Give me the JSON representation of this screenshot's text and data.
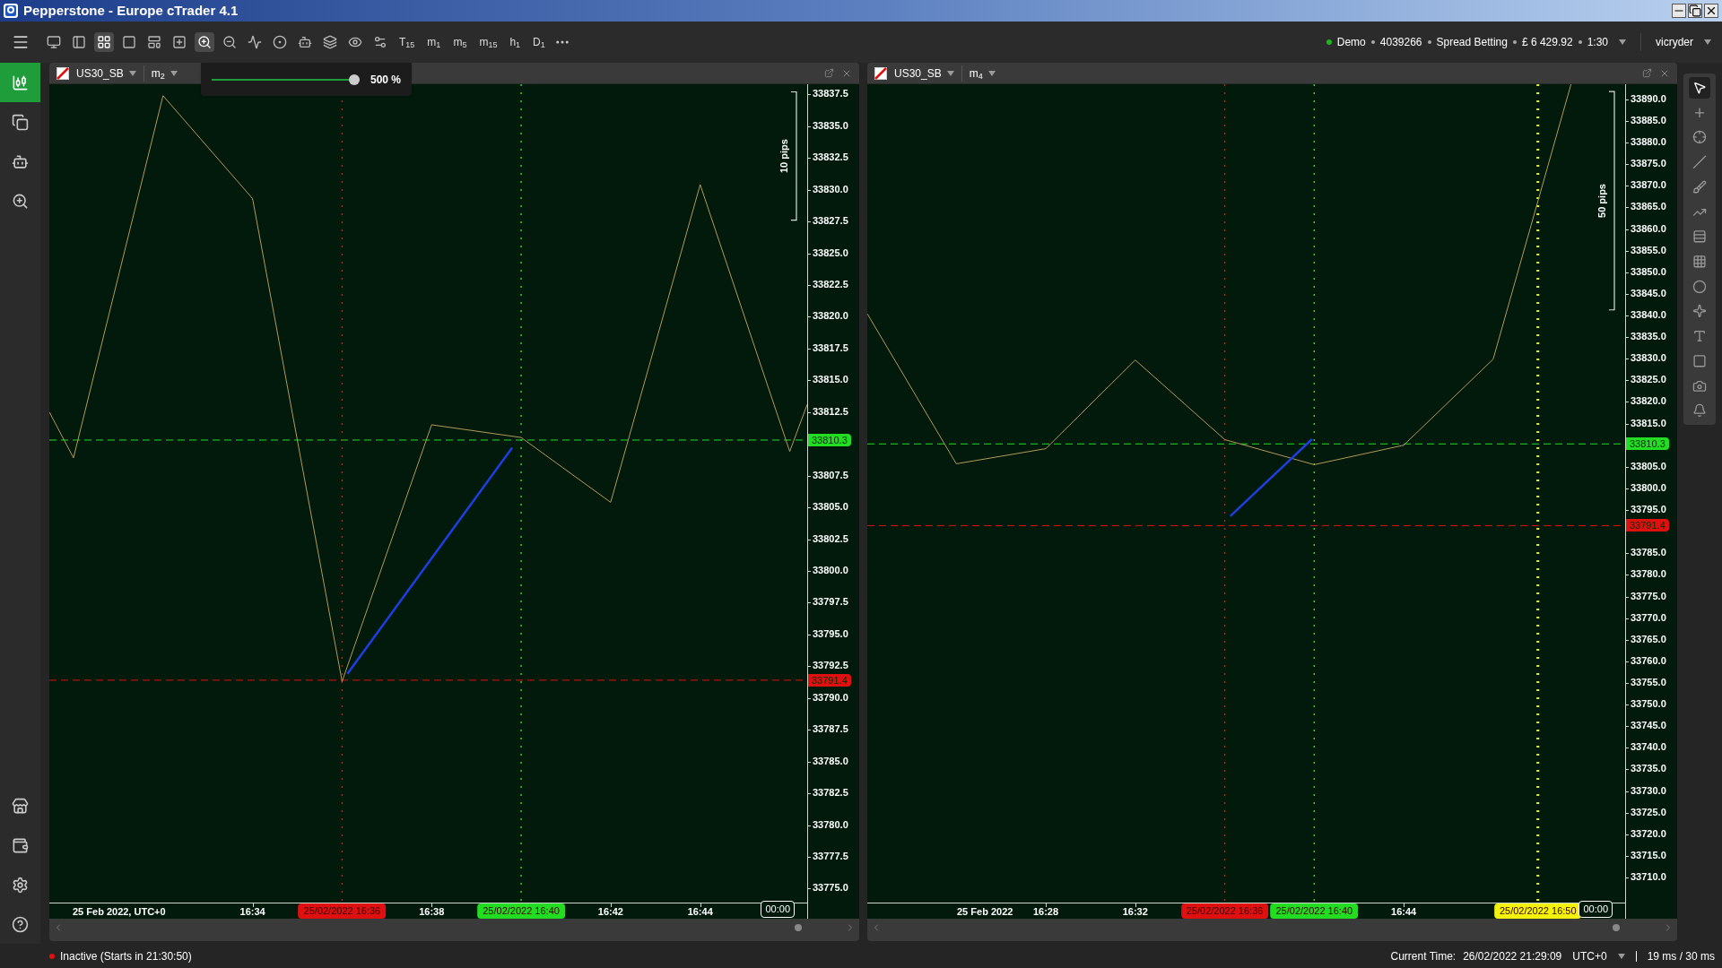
{
  "window": {
    "title": "Pepperstone - Europe cTrader 4.1"
  },
  "toolbar": {
    "tools": [
      {
        "selected": false
      },
      {
        "selected": false
      },
      {
        "selected": true
      },
      {
        "selected": false
      },
      {
        "selected": false
      },
      {
        "selected": false
      },
      {
        "selected": true
      },
      {
        "selected": false
      },
      {
        "selected": false
      },
      {
        "selected": false
      },
      {
        "selected": false
      },
      {
        "selected": false
      },
      {
        "selected": false
      },
      {
        "selected": false
      }
    ],
    "timeframes": [
      "T$_{15}$",
      "m$_{1}$",
      "m$_{5}$",
      "m$_{15}$",
      "h$_{1}$",
      "D$_{1}$"
    ]
  },
  "account": {
    "mode": "Demo",
    "number": "4039266",
    "type": "Spread Betting",
    "balance": "£ 6 429.92",
    "leverage": "1:30",
    "user": "vicryder"
  },
  "zoom_popup": {
    "level": 1,
    "reading": "500 %"
  },
  "sidebar": {
    "items": [
      {
        "selected": true
      },
      {
        "selected": false
      },
      {
        "selected": false
      },
      {
        "selected": false
      },
      {
        "selected": false
      },
      {
        "selected": false
      },
      {
        "selected": false
      },
      {
        "selected": false
      }
    ]
  },
  "charts": [
    {
      "symbol": "US30_SB",
      "timeframe": "m$_{2}$",
      "countdown": "00:00",
      "pips_ruler": "10 pips",
      "date_label": "25 Feb 2022, UTC+0",
      "marker_labels": [
        "25/02/2022 16:36",
        "25/02/2022 16:40"
      ],
      "chart_data": {
        "type": "line",
        "x": [
          989.46,
          990,
          992,
          994,
          996,
          998,
          1000,
          1002,
          1004,
          1006,
          1006.39
        ],
        "values": [
          33812.5,
          33808.9,
          33837.4,
          33829.3,
          33791.3,
          33811.5,
          33810.5,
          33805.4,
          33830.4,
          33809.4,
          33813.1
        ],
        "xlim": [
          989.46,
          1006.39
        ],
        "ylim": [
          33773.9,
          33838.3
        ],
        "xticks": [
          {
            "value": 994,
            "label": "16:34"
          },
          {
            "value": 998,
            "label": "16:38"
          },
          {
            "value": 1002,
            "label": "16:42"
          },
          {
            "value": 1004,
            "label": "16:44"
          }
        ],
        "yticks": [
          {
            "value": 33837.5,
            "label": "33837.5"
          },
          {
            "value": 33835,
            "label": "33835.0"
          },
          {
            "value": 33832.5,
            "label": "33832.5"
          },
          {
            "value": 33830,
            "label": "33830.0"
          },
          {
            "value": 33827.5,
            "label": "33827.5"
          },
          {
            "value": 33825,
            "label": "33825.0"
          },
          {
            "value": 33822.5,
            "label": "33822.5"
          },
          {
            "value": 33820,
            "label": "33820.0"
          },
          {
            "value": 33817.5,
            "label": "33817.5"
          },
          {
            "value": 33815,
            "label": "33815.0"
          },
          {
            "value": 33812.5,
            "label": "33812.5"
          },
          {
            "value": 33807.5,
            "label": "33807.5"
          },
          {
            "value": 33805,
            "label": "33805.0"
          },
          {
            "value": 33802.5,
            "label": "33802.5"
          },
          {
            "value": 33800,
            "label": "33800.0"
          },
          {
            "value": 33797.5,
            "label": "33797.5"
          },
          {
            "value": 33795,
            "label": "33795.0"
          },
          {
            "value": 33792.5,
            "label": "33792.5"
          },
          {
            "value": 33790,
            "label": "33790.0"
          },
          {
            "value": 33787.5,
            "label": "33787.5"
          },
          {
            "value": 33785,
            "label": "33785.0"
          },
          {
            "value": 33782.5,
            "label": "33782.5"
          },
          {
            "value": 33780,
            "label": "33780.0"
          },
          {
            "value": 33777.5,
            "label": "33777.5"
          },
          {
            "value": 33775,
            "label": "33775.0"
          }
        ],
        "ref_lines": [
          {
            "axis": "y",
            "value": 33810.3,
            "label": "33810.3",
            "color": "#22dd22"
          },
          {
            "axis": "y",
            "value": 33791.4,
            "label": "33791.4",
            "color": "#e01010"
          },
          {
            "axis": "x",
            "value": 996,
            "color": "#e01010"
          },
          {
            "axis": "x",
            "value": 1000,
            "color": "#22dd22"
          }
        ]
      }
    },
    {
      "symbol": "US30_SB",
      "timeframe": "m$_{4}$",
      "countdown": "00:00",
      "pips_ruler": "50 pips",
      "date_label": "25 Feb 2022",
      "marker_labels": [
        "25/02/2022 16:36",
        "25/02/2022 16:40",
        "25/02/2022 16:50"
      ],
      "chart_data": {
        "type": "line",
        "x": [
          980.02,
          984,
          988,
          992,
          996,
          1000,
          1004,
          1008,
          1011.48
        ],
        "values": [
          33840.4,
          33805.7,
          33809.2,
          33829.7,
          33811.3,
          33805.5,
          33810.0,
          33829.9,
          33893.5
        ],
        "xlim": [
          980.02,
          1013.9
        ],
        "ylim": [
          33704.2,
          33893.5
        ],
        "xticks": [
          {
            "value": 988,
            "label": "16:28"
          },
          {
            "value": 992,
            "label": "16:32"
          },
          {
            "value": 1004,
            "label": "16:44"
          }
        ],
        "yticks": [
          {
            "value": 33890,
            "label": "33890.0"
          },
          {
            "value": 33885,
            "label": "33885.0"
          },
          {
            "value": 33880,
            "label": "33880.0"
          },
          {
            "value": 33875,
            "label": "33875.0"
          },
          {
            "value": 33870,
            "label": "33870.0"
          },
          {
            "value": 33865,
            "label": "33865.0"
          },
          {
            "value": 33860,
            "label": "33860.0"
          },
          {
            "value": 33855,
            "label": "33855.0"
          },
          {
            "value": 33850,
            "label": "33850.0"
          },
          {
            "value": 33845,
            "label": "33845.0"
          },
          {
            "value": 33840,
            "label": "33840.0"
          },
          {
            "value": 33835,
            "label": "33835.0"
          },
          {
            "value": 33830,
            "label": "33830.0"
          },
          {
            "value": 33825,
            "label": "33825.0"
          },
          {
            "value": 33820,
            "label": "33820.0"
          },
          {
            "value": 33815,
            "label": "33815.0"
          },
          {
            "value": 33805,
            "label": "33805.0"
          },
          {
            "value": 33800,
            "label": "33800.0"
          },
          {
            "value": 33795,
            "label": "33795.0"
          },
          {
            "value": 33785,
            "label": "33785.0"
          },
          {
            "value": 33780,
            "label": "33780.0"
          },
          {
            "value": 33775,
            "label": "33775.0"
          },
          {
            "value": 33770,
            "label": "33770.0"
          },
          {
            "value": 33765,
            "label": "33765.0"
          },
          {
            "value": 33760,
            "label": "33760.0"
          },
          {
            "value": 33755,
            "label": "33755.0"
          },
          {
            "value": 33750,
            "label": "33750.0"
          },
          {
            "value": 33745,
            "label": "33745.0"
          },
          {
            "value": 33740,
            "label": "33740.0"
          },
          {
            "value": 33735,
            "label": "33735.0"
          },
          {
            "value": 33730,
            "label": "33730.0"
          },
          {
            "value": 33725,
            "label": "33725.0"
          },
          {
            "value": 33720,
            "label": "33720.0"
          },
          {
            "value": 33715,
            "label": "33715.0"
          },
          {
            "value": 33710,
            "label": "33710.0"
          }
        ],
        "ref_lines": [
          {
            "axis": "y",
            "value": 33810.3,
            "label": "33810.3",
            "color": "#22dd22"
          },
          {
            "axis": "y",
            "value": 33791.4,
            "label": "33791.4",
            "color": "#e01010"
          },
          {
            "axis": "x",
            "value": 996,
            "color": "#e01010"
          },
          {
            "axis": "x",
            "value": 1000,
            "color": "#22dd22"
          },
          {
            "axis": "x",
            "value": 1010,
            "color": "#f2f20a"
          }
        ]
      }
    }
  ],
  "drawing_tools": [
    {
      "selected": true
    },
    {
      "selected": false
    },
    {
      "selected": false
    },
    {
      "selected": false
    },
    {
      "selected": false
    },
    {
      "selected": false
    },
    {
      "selected": false
    },
    {
      "selected": false
    },
    {
      "selected": false
    },
    {
      "selected": false
    },
    {
      "selected": false
    },
    {
      "selected": false
    },
    {
      "selected": false
    },
    {
      "selected": false
    }
  ],
  "status_bar": {
    "session": "Inactive (Starts in 21:30:50)",
    "current_time_label": "Current Time:",
    "current_time": "26/02/2022 21:29:09",
    "timezone": "UTC+0",
    "latency": "19 ms / 30 ms"
  }
}
